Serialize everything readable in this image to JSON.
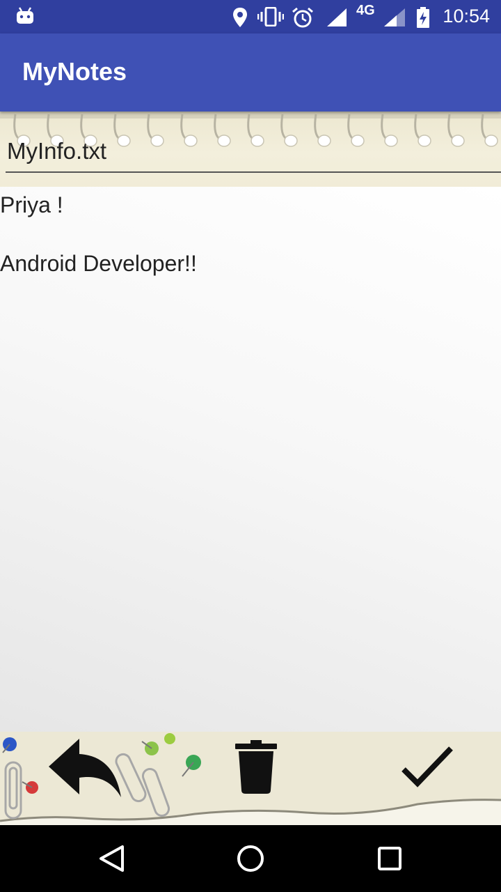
{
  "status_bar": {
    "time": "10:54",
    "network": "4G",
    "icons": [
      "android-notification-icon",
      "location-icon",
      "vibrate-icon",
      "alarm-icon",
      "signal-icon",
      "signal-icon",
      "battery-charging-icon"
    ]
  },
  "app_bar": {
    "title": "MyNotes"
  },
  "note": {
    "filename": "MyInfo.txt",
    "lines": [
      "Priya !",
      "Android Developer!!"
    ]
  },
  "actions": {
    "icons": [
      "reply-icon",
      "trash-icon",
      "check-icon"
    ]
  },
  "nav_bar": {
    "icons": [
      "back-icon",
      "home-icon",
      "recents-icon"
    ]
  },
  "colors": {
    "status_bar": "#303f9f",
    "app_bar": "#3f51b5"
  }
}
